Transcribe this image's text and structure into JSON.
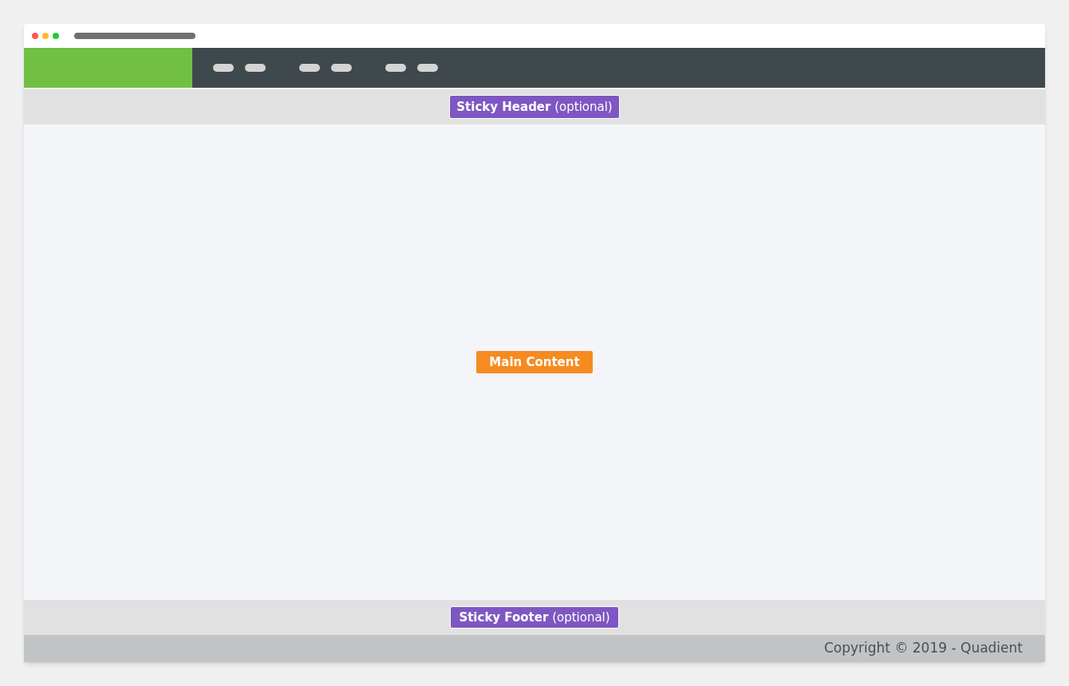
{
  "sticky_header": {
    "label": "**Sticky Header** (optional)"
  },
  "main_content": {
    "label": "Main Content"
  },
  "sticky_footer": {
    "label": "**Sticky Footer** (optional)"
  },
  "copyright": "Copyright © 2019 - Quadient"
}
